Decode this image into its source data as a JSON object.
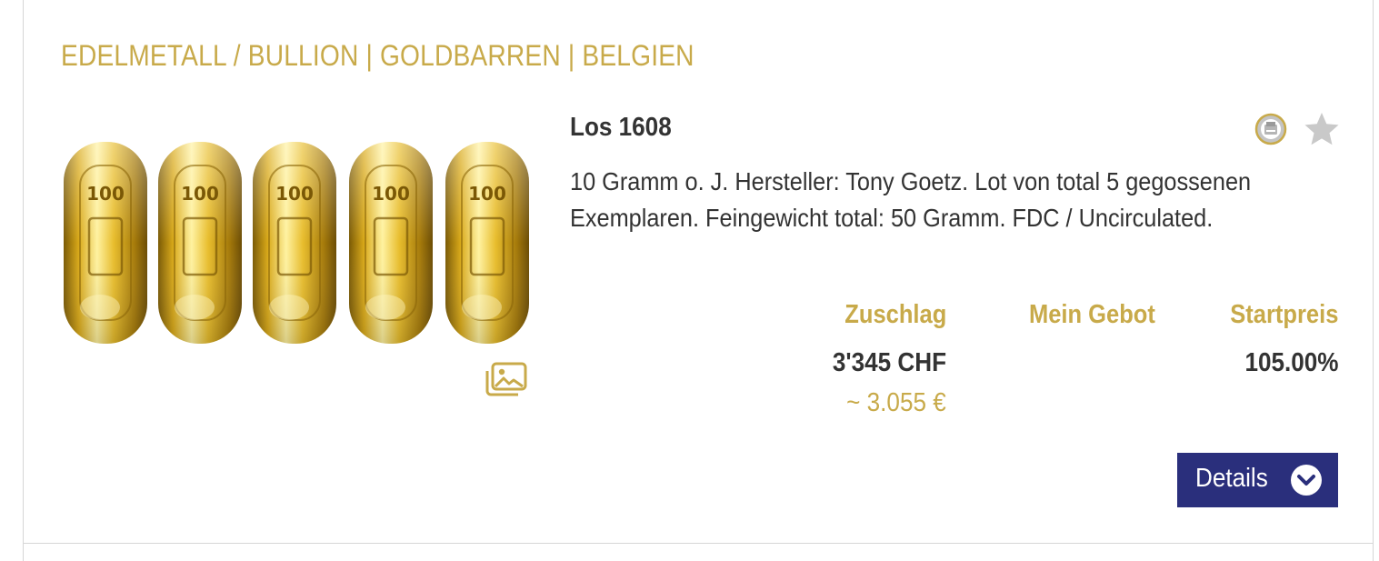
{
  "breadcrumb": "EDELMETALL / BULLION | GOLDBARREN | BELGIEN",
  "lot": {
    "title": "Los 1608",
    "description": "10 Gramm o. J. Hersteller: Tony Goetz. Lot von total 5 gegossenen Exemplaren. Feingewicht total: 50 Gramm. FDC / Uncirculated."
  },
  "image": {
    "alt": "Fünf Goldbarren 10 Gramm",
    "bar_stamp": "100"
  },
  "columns": {
    "hammer_label": "Zuschlag",
    "my_bid_label": "Mein Gebot",
    "start_label": "Startpreis"
  },
  "values": {
    "hammer_price": "3'345 CHF",
    "hammer_price_eur": "~ 3.055 €",
    "my_bid": "",
    "start_price": "105.00%"
  },
  "buttons": {
    "details_label": "Details"
  },
  "icons": {
    "document": "document-circle-icon",
    "star": "star-icon",
    "gallery": "image-gallery-icon",
    "chevron": "chevron-down-icon"
  },
  "colors": {
    "gold_text": "#c8aa4a",
    "button_bg": "#2a2f7c",
    "text": "#333333"
  }
}
